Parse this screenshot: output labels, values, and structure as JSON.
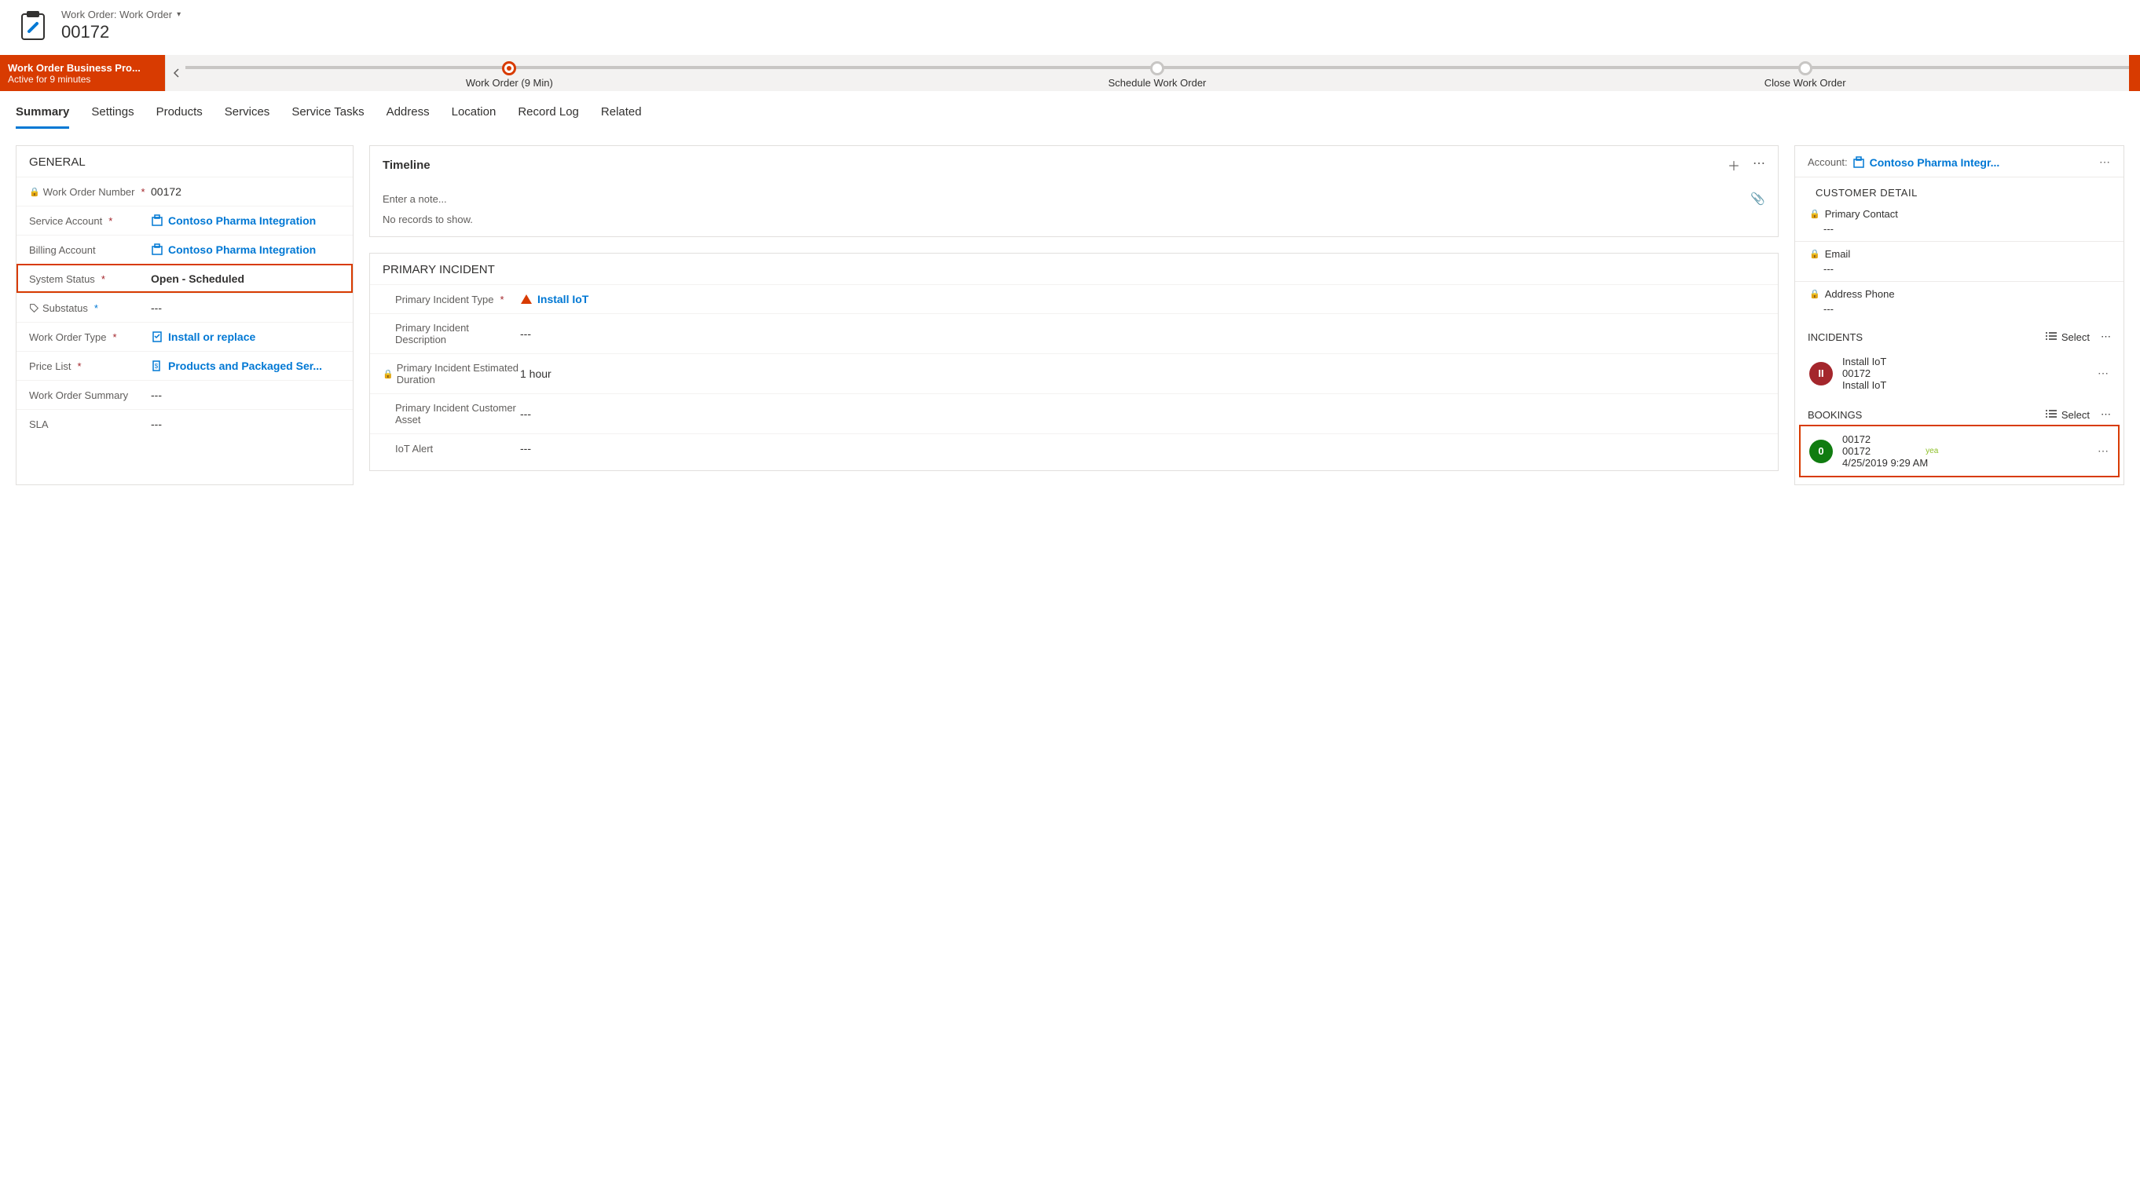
{
  "header": {
    "entity_label": "Work Order: Work Order",
    "record_name": "00172"
  },
  "bpf": {
    "name": "Work Order Business Pro...",
    "active_text": "Active for 9 minutes",
    "stages": [
      {
        "label": "Work Order  (9 Min)",
        "active": true
      },
      {
        "label": "Schedule Work Order",
        "active": false
      },
      {
        "label": "Close Work Order",
        "active": false
      }
    ]
  },
  "tabs": [
    "Summary",
    "Settings",
    "Products",
    "Services",
    "Service Tasks",
    "Address",
    "Location",
    "Record Log",
    "Related"
  ],
  "active_tab": "Summary",
  "general": {
    "title": "GENERAL",
    "work_order_number": {
      "label": "Work Order Number",
      "value": "00172"
    },
    "service_account": {
      "label": "Service Account",
      "value": "Contoso Pharma Integration"
    },
    "billing_account": {
      "label": "Billing Account",
      "value": "Contoso Pharma Integration"
    },
    "system_status": {
      "label": "System Status",
      "value": "Open - Scheduled"
    },
    "substatus": {
      "label": "Substatus",
      "value": "---"
    },
    "work_order_type": {
      "label": "Work Order Type",
      "value": "Install or replace"
    },
    "price_list": {
      "label": "Price List",
      "value": "Products and Packaged Ser..."
    },
    "work_order_summary": {
      "label": "Work Order Summary",
      "value": "---"
    },
    "sla": {
      "label": "SLA",
      "value": "---"
    }
  },
  "timeline": {
    "title": "Timeline",
    "placeholder": "Enter a note...",
    "empty": "No records to show."
  },
  "primary_incident": {
    "title": "PRIMARY INCIDENT",
    "type": {
      "label": "Primary Incident Type",
      "value": "Install IoT"
    },
    "description": {
      "label": "Primary Incident Description",
      "value": "---"
    },
    "est_duration": {
      "label": "Primary Incident Estimated Duration",
      "value": "1 hour"
    },
    "customer_asset": {
      "label": "Primary Incident Customer Asset",
      "value": "---"
    },
    "iot_alert": {
      "label": "IoT Alert",
      "value": "---"
    }
  },
  "right": {
    "account_label": "Account:",
    "account_value": "Contoso Pharma Integr...",
    "customer_detail_title": "CUSTOMER DETAIL",
    "primary_contact": {
      "label": "Primary Contact",
      "value": "---"
    },
    "email": {
      "label": "Email",
      "value": "---"
    },
    "address_phone": {
      "label": "Address Phone",
      "value": "---"
    }
  },
  "incidents": {
    "title": "INCIDENTS",
    "select_label": "Select",
    "items": [
      {
        "initials": "II",
        "line1": "Install IoT",
        "line2": "00172",
        "line3": "Install IoT"
      }
    ]
  },
  "bookings": {
    "title": "BOOKINGS",
    "select_label": "Select",
    "items": [
      {
        "initials": "0",
        "line1": "00172",
        "line2": "00172",
        "line3": "4/25/2019 9:29 AM",
        "tag": "yea"
      }
    ]
  }
}
